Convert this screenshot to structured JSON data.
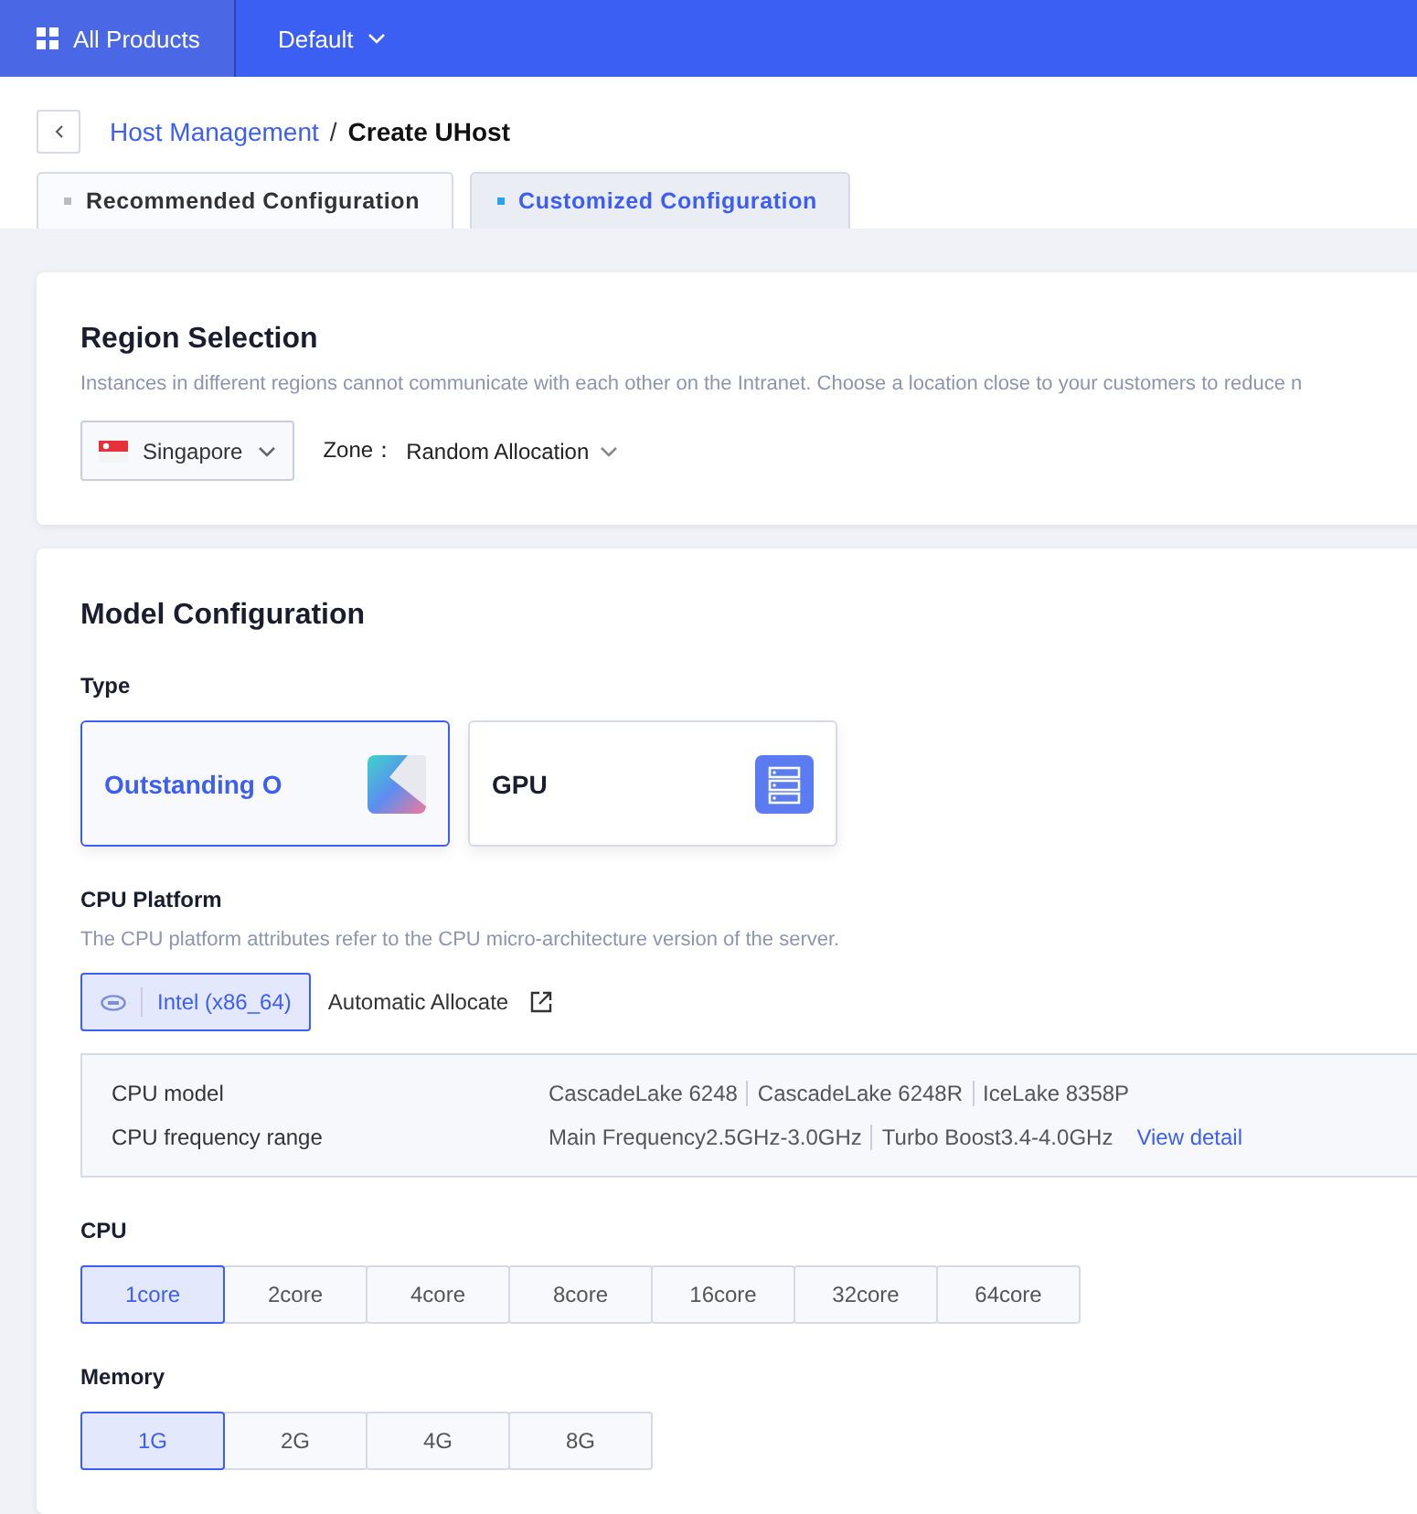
{
  "topbar": {
    "products": "All Products",
    "project": "Default"
  },
  "breadcrumb": {
    "parent": "Host Management",
    "separator": "/",
    "current": "Create UHost"
  },
  "tabs": [
    {
      "label": "Recommended Configuration",
      "selected": false
    },
    {
      "label": "Customized Configuration",
      "selected": true
    }
  ],
  "region": {
    "title": "Region Selection",
    "description": "Instances in different regions cannot communicate with each other on the Intranet. Choose a location close to your customers to reduce n",
    "region_value": "Singapore",
    "zone_label": "Zone：",
    "zone_value": "Random Allocation"
  },
  "model": {
    "title": "Model Configuration",
    "type_label": "Type",
    "types": [
      {
        "label": "Outstanding O",
        "kind": "gradient",
        "selected": true
      },
      {
        "label": "GPU",
        "kind": "server",
        "selected": false
      }
    ],
    "platform_label": "CPU Platform",
    "platform_description": "The CPU platform attributes refer to the CPU micro-architecture version of the server.",
    "platforms": [
      {
        "label": "Intel (x86_64)",
        "kind": "chip",
        "selected": true
      },
      {
        "label": "Automatic Allocate",
        "kind": "external",
        "selected": false
      }
    ],
    "specs": [
      {
        "label": "CPU model",
        "values": [
          "CascadeLake 6248",
          "CascadeLake 6248R",
          "IceLake 8358P"
        ]
      },
      {
        "label": "CPU frequency range",
        "values": [
          "Main Frequency2.5GHz-3.0GHz",
          "Turbo Boost3.4-4.0GHz"
        ],
        "link": "View detail"
      }
    ],
    "cpu_label": "CPU",
    "cpu": [
      {
        "label": "1core",
        "selected": true
      },
      {
        "label": "2core",
        "selected": false
      },
      {
        "label": "4core",
        "selected": false
      },
      {
        "label": "8core",
        "selected": false
      },
      {
        "label": "16core",
        "selected": false
      },
      {
        "label": "32core",
        "selected": false
      },
      {
        "label": "64core",
        "selected": false
      }
    ],
    "memory_label": "Memory",
    "memory": [
      {
        "label": "1G",
        "selected": true
      },
      {
        "label": "2G",
        "selected": false
      },
      {
        "label": "4G",
        "selected": false
      },
      {
        "label": "8G",
        "selected": false
      }
    ]
  }
}
